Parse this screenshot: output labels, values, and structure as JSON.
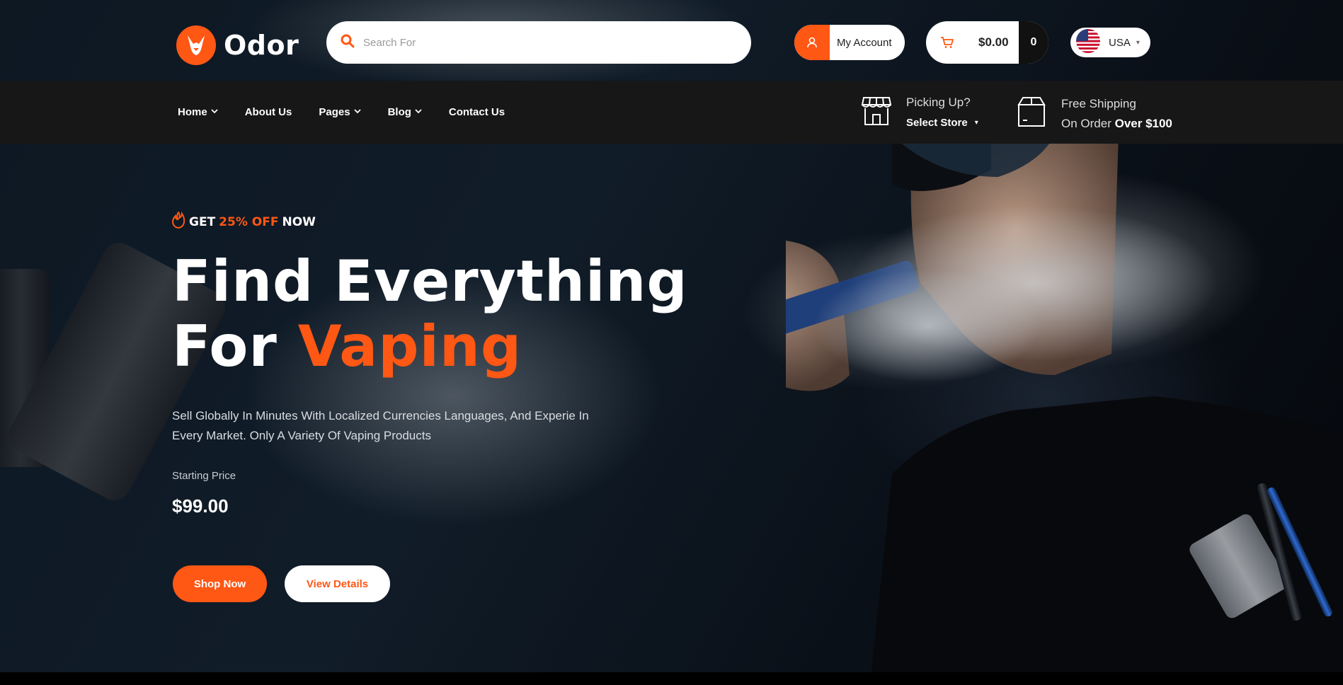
{
  "brand": {
    "name": "Odor",
    "accent": "#ff5714"
  },
  "search": {
    "placeholder": "Search For"
  },
  "account": {
    "label": "My Account"
  },
  "cart": {
    "total": "$0.00",
    "count": "0"
  },
  "currency": {
    "label": "USA"
  },
  "nav": {
    "items": [
      {
        "label": "Home"
      },
      {
        "label": "About Us"
      },
      {
        "label": "Pages"
      },
      {
        "label": "Blog"
      },
      {
        "label": "Contact Us"
      }
    ]
  },
  "store": {
    "title": "Picking Up?",
    "select": "Select Store"
  },
  "shipping": {
    "title": "Free Shipping",
    "line_prefix": "On Order",
    "line_bold": "Over $100"
  },
  "hero": {
    "promo_prefix": "GET",
    "promo_highlight": "25% OFF",
    "promo_suffix": "NOW",
    "title_line1": "Find Everything",
    "title_line2_plain": "For",
    "title_line2_accent": "Vaping",
    "description": "Sell Globally In Minutes With Localized Currencies Languages, And Experie In Every Market. Only A Variety Of Vaping Products",
    "starting_price_label": "Starting Price",
    "starting_price": "$99.00",
    "shop_button": "Shop Now",
    "details_button": "View Details"
  }
}
